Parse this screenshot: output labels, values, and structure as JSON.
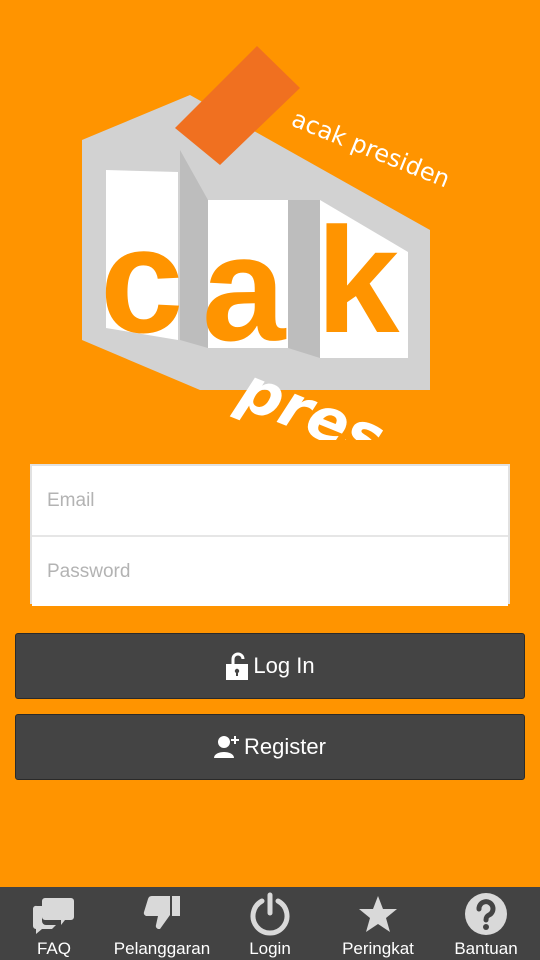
{
  "logo": {
    "tagline": "acak presiden",
    "letters": [
      "c",
      "a",
      "k"
    ],
    "subword": "pres"
  },
  "login_form": {
    "email_placeholder": "Email",
    "password_placeholder": "Password"
  },
  "buttons": {
    "login_label": "Log In",
    "register_label": "Register"
  },
  "bottom_nav": {
    "items": [
      {
        "label": "FAQ",
        "icon": "chat-bubbles-icon"
      },
      {
        "label": "Pelanggaran",
        "icon": "thumbs-down-icon"
      },
      {
        "label": "Login",
        "icon": "power-icon"
      },
      {
        "label": "Peringkat",
        "icon": "star-icon"
      },
      {
        "label": "Bantuan",
        "icon": "help-icon"
      }
    ]
  },
  "colors": {
    "background": "#ff9400",
    "logo_box": "#d4d4d4",
    "logo_card": "#f07020",
    "button_bg": "#444444",
    "nav_bg": "#434343",
    "icon_gray": "#d9d9d9"
  }
}
